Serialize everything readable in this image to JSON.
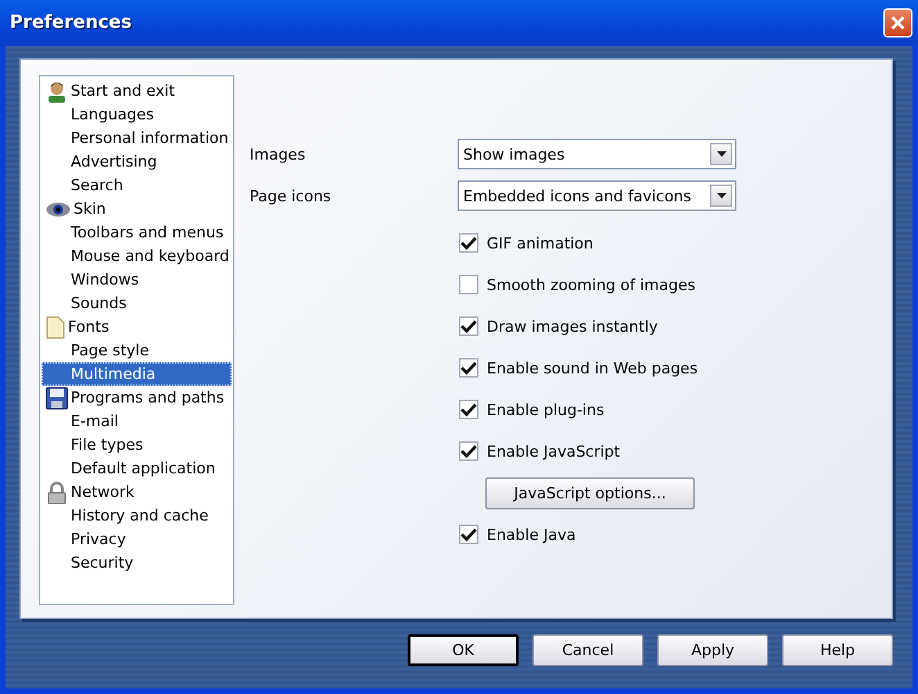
{
  "window": {
    "title": "Preferences"
  },
  "sidebar": {
    "items": [
      {
        "label": "Start and exit",
        "selected": false,
        "kind": "figure"
      },
      {
        "label": "Languages",
        "selected": false,
        "kind": "plain"
      },
      {
        "label": "Personal information",
        "selected": false,
        "kind": "plain"
      },
      {
        "label": "Advertising",
        "selected": false,
        "kind": "plain"
      },
      {
        "label": "Search",
        "selected": false,
        "kind": "plain"
      },
      {
        "label": "Skin",
        "selected": false,
        "kind": "eye"
      },
      {
        "label": "Toolbars and menus",
        "selected": false,
        "kind": "plain"
      },
      {
        "label": "Mouse and keyboard",
        "selected": false,
        "kind": "plain"
      },
      {
        "label": "Windows",
        "selected": false,
        "kind": "plain"
      },
      {
        "label": "Sounds",
        "selected": false,
        "kind": "plain"
      },
      {
        "label": "Fonts",
        "selected": false,
        "kind": "page"
      },
      {
        "label": "Page style",
        "selected": false,
        "kind": "plain"
      },
      {
        "label": "Multimedia",
        "selected": true,
        "kind": "plain"
      },
      {
        "label": "Programs and paths",
        "selected": false,
        "kind": "disk"
      },
      {
        "label": "E-mail",
        "selected": false,
        "kind": "plain"
      },
      {
        "label": "File types",
        "selected": false,
        "kind": "plain"
      },
      {
        "label": "Default application",
        "selected": false,
        "kind": "plain"
      },
      {
        "label": "Network",
        "selected": false,
        "kind": "lock"
      },
      {
        "label": "History and cache",
        "selected": false,
        "kind": "plain"
      },
      {
        "label": "Privacy",
        "selected": false,
        "kind": "plain"
      },
      {
        "label": "Security",
        "selected": false,
        "kind": "plain"
      }
    ]
  },
  "dropdowns": [
    {
      "label": "Images",
      "value": "Show images"
    },
    {
      "label": "Page icons",
      "value": "Embedded icons and favicons"
    }
  ],
  "options": [
    {
      "kind": "checkbox",
      "label": "GIF animation",
      "checked": true
    },
    {
      "kind": "checkbox",
      "label": "Smooth zooming of images",
      "checked": false
    },
    {
      "kind": "checkbox",
      "label": "Draw images instantly",
      "checked": true
    },
    {
      "kind": "checkbox",
      "label": "Enable sound in Web pages",
      "checked": true
    },
    {
      "kind": "checkbox",
      "label": "Enable plug-ins",
      "checked": true
    },
    {
      "kind": "checkbox",
      "label": "Enable JavaScript",
      "checked": true
    },
    {
      "kind": "button",
      "label": "JavaScript options..."
    },
    {
      "kind": "checkbox",
      "label": "Enable Java",
      "checked": true
    }
  ],
  "buttons": [
    {
      "label": "OK",
      "default": true
    },
    {
      "label": "Cancel",
      "default": false
    },
    {
      "label": "Apply",
      "default": false
    },
    {
      "label": "Help",
      "default": false
    }
  ]
}
